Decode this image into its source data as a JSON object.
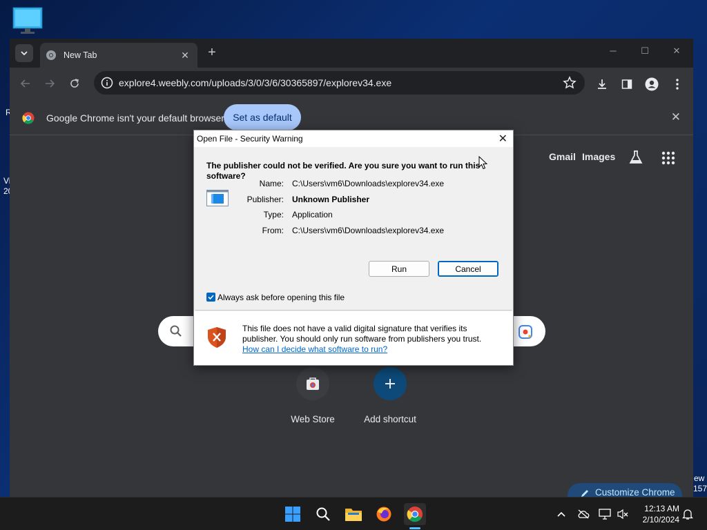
{
  "desktop": {
    "fragments": [
      "R",
      "Vi",
      "20",
      "ew",
      "157"
    ]
  },
  "browser": {
    "tab_title": "New Tab",
    "url": "explore4.weebly.com/uploads/3/0/3/6/30365897/explorev34.exe",
    "infobar_text": "Google Chrome isn't your default browser",
    "set_default_label": "Set as default",
    "links": {
      "gmail": "Gmail",
      "images": "Images"
    },
    "shortcuts": [
      {
        "label": "Web Store"
      },
      {
        "label": "Add shortcut"
      }
    ],
    "customize_label": "Customize Chrome"
  },
  "dialog": {
    "title": "Open File - Security Warning",
    "heading": "The publisher could not be verified.  Are you sure you want to run this software?",
    "fields": {
      "name_label": "Name:",
      "name_value": "C:\\Users\\vm6\\Downloads\\explorev34.exe",
      "publisher_label": "Publisher:",
      "publisher_value": "Unknown Publisher",
      "type_label": "Type:",
      "type_value": "Application",
      "from_label": "From:",
      "from_value": "C:\\Users\\vm6\\Downloads\\explorev34.exe"
    },
    "run_label": "Run",
    "cancel_label": "Cancel",
    "checkbox_label": "Always ask before opening this file",
    "checkbox_checked": true,
    "footer_text": "This file does not have a valid digital signature that verifies its publisher.  You should only run software from publishers you trust.",
    "footer_link": "How can I decide what software to run?"
  },
  "taskbar": {
    "time": "12:13 AM",
    "date": "2/10/2024"
  },
  "colors": {
    "accent": "#0067c0",
    "chrome_bg": "#35363a",
    "set_default_bg": "#a8c7fa"
  }
}
